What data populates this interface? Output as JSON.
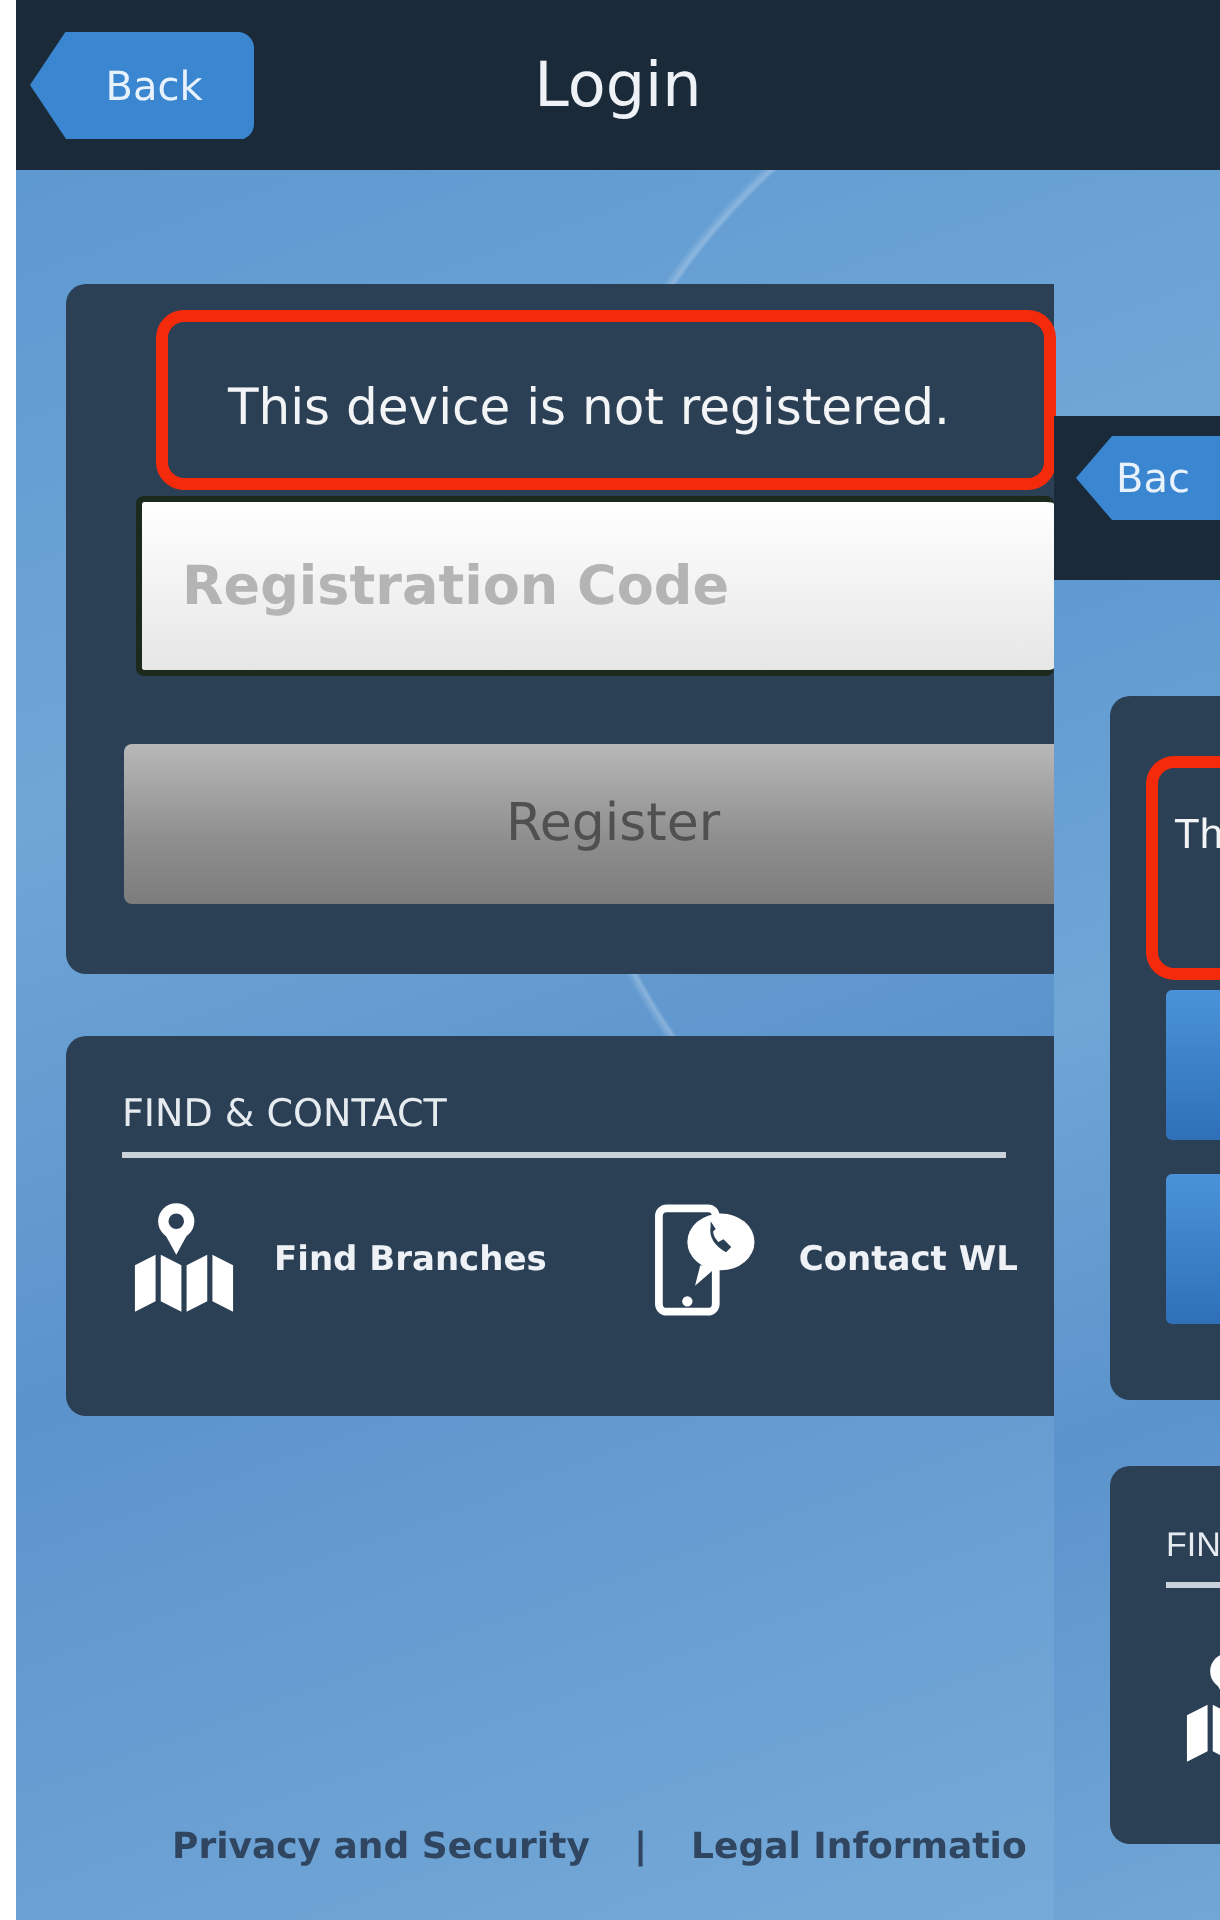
{
  "screen_1": {
    "header": {
      "back": "Back",
      "title": "Login"
    },
    "notice": {
      "text": "This device is not registered.",
      "highlighted": true
    },
    "registration_field": {
      "placeholder": "Registration Code"
    },
    "register_button": "Register",
    "find_contact": {
      "heading": "FIND & CONTACT",
      "links": [
        {
          "kind": "map",
          "label": "Find Branches"
        },
        {
          "kind": "phone",
          "label": "Contact WL"
        }
      ]
    },
    "footer": {
      "links": [
        "Privacy and Security",
        "Legal Informatio"
      ],
      "separator": "|"
    }
  },
  "screen_2": {
    "header": {
      "back": "Bac"
    },
    "notice": {
      "text": "Th",
      "highlighted": true
    },
    "find_contact": {
      "heading": "FIN",
      "links": [
        {
          "kind": "map"
        }
      ]
    }
  }
}
